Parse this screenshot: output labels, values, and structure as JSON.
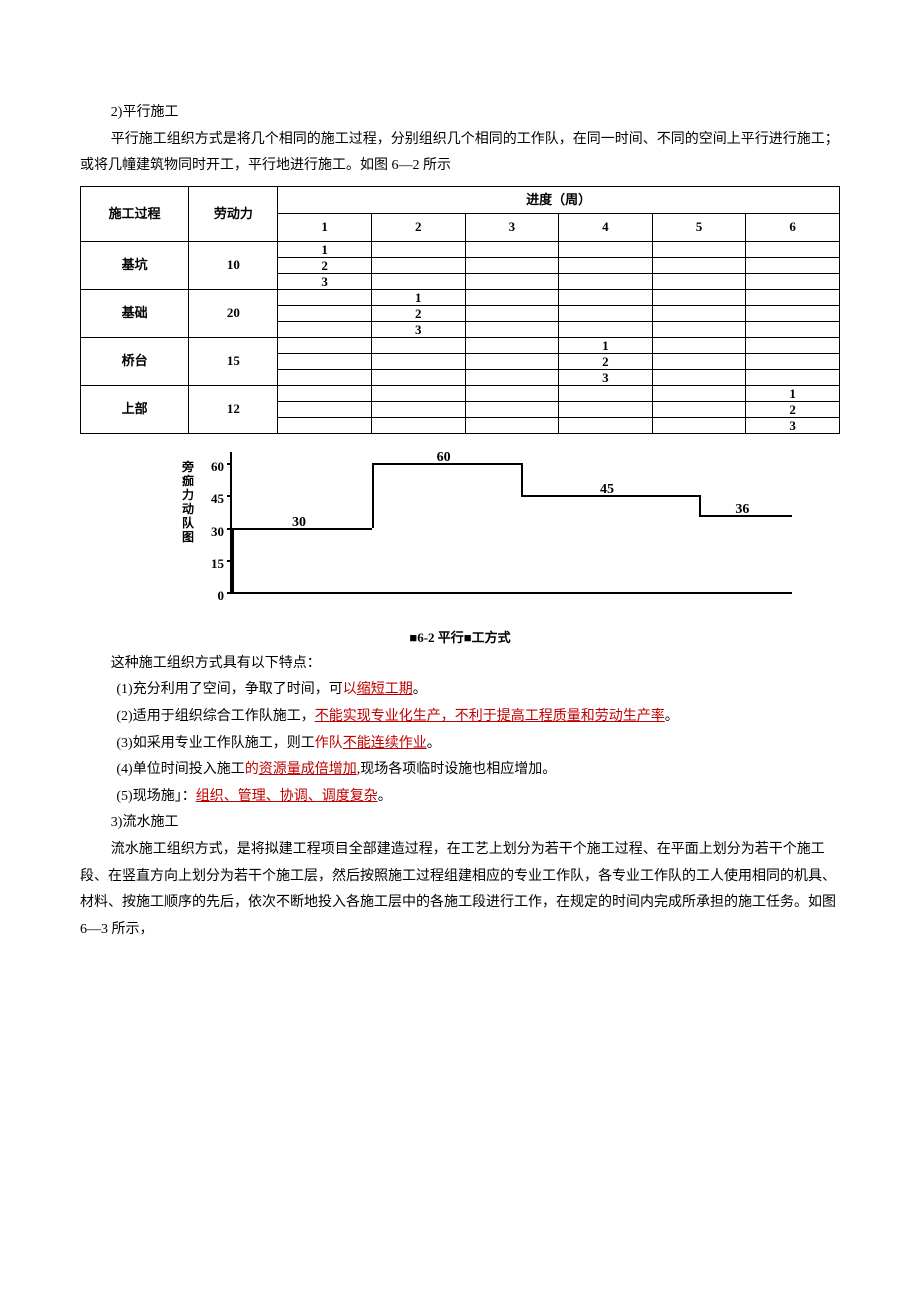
{
  "domain": "Document",
  "body": {
    "h2a_num": "2)",
    "h2a_title": "平行施工",
    "p1": "平行施工组织方式是将几个相同的施工过程，分别组织几个相同的工作队，在同一时间、不同的空间上平行进行施工；或将几幢建筑物同时开工，平行地进行施工。如图 6—2 所示",
    "intro2": "这种施工组织方式具有以下特点：",
    "pt1a": "(1)充分利用了空间，争取了时间，可",
    "pt1b": "以",
    "pt1c": "缩短工期",
    "pt1d": "。",
    "pt2a": "(2)适用于组织综合工作队施工，",
    "pt2b": "不能实现专业化生产，不利于提高工程质量和劳动生产率",
    "pt2c": "。",
    "pt3a": "(3)如采用专业工作队施工，则工",
    "pt3b": "作队",
    "pt3c": "不能连续作业",
    "pt3d": "。",
    "pt4a": "(4)单位时间投入施工",
    "pt4b": "的",
    "pt4c": "资源量成倍增加",
    "pt4d": ",现场各项临时设施也相应增加。",
    "pt5a": "(5)现场施」：",
    "pt5b": "组织、管理、协调、调度复杂",
    "pt5c": "。",
    "h2b_num": "3)",
    "h2b_title": "流水施工",
    "p2": "流水施工组织方式，是将拟建工程项目全部建造过程，在工艺上划分为若干个施工过程、在平面上划分为若干个施工段、在竖直方向上划分为若干个施工层，然后按照施工过程组建相应的专业工作队，各专业工作队的工人使用相同的机具、材料、按施工顺序的先后，依次不断地投入各施工层中的各施工段进行工作，在规定的时间内完成所承担的施工任务。如图 6—3 所示，"
  },
  "schedule_table": {
    "col_proc": "施工过程",
    "col_labor": "劳动力",
    "col_prog": "进度（周）",
    "weeks": [
      "1",
      "2",
      "3",
      "4",
      "5",
      "6"
    ],
    "rows": [
      {
        "proc": "基坑",
        "labor": "10",
        "segments": [
          {
            "col": 0,
            "n": "1"
          },
          {
            "col": 0,
            "n": "2"
          },
          {
            "col": 0,
            "n": "3"
          }
        ]
      },
      {
        "proc": "基础",
        "labor": "20",
        "segments": [
          {
            "col": 1,
            "n": "1"
          },
          {
            "col": 1,
            "n": "2"
          },
          {
            "col": 1,
            "n": "3"
          }
        ]
      },
      {
        "proc": "桥台",
        "labor": "15",
        "segments": [
          {
            "col": 3,
            "n": "1"
          },
          {
            "col": 3,
            "n": "2"
          },
          {
            "col": 3,
            "n": "3"
          }
        ]
      },
      {
        "proc": "上部",
        "labor": "12",
        "segments": [
          {
            "col": 5,
            "n": "1"
          },
          {
            "col": 5,
            "n": "2"
          },
          {
            "col": 5,
            "n": "3"
          }
        ]
      }
    ]
  },
  "chart_data": {
    "type": "step-line",
    "ylabel_vert": "旁痂力动队图",
    "ylabel_note": "劳动力动态图",
    "yticks": [
      0,
      15,
      30,
      45,
      60
    ],
    "ylim": [
      0,
      65
    ],
    "xlim": [
      0,
      6
    ],
    "steps": [
      {
        "x0": 0,
        "x1": 1.5,
        "y": 30,
        "label": "30"
      },
      {
        "x0": 1.5,
        "x1": 3.1,
        "y": 60,
        "label": "60"
      },
      {
        "x0": 3.1,
        "x1": 5.0,
        "y": 45,
        "label": "45"
      },
      {
        "x0": 5.0,
        "x1": 6.0,
        "y": 36,
        "label": "36"
      }
    ],
    "caption_a": "■6-2",
    "caption_b": " 平行■工方式"
  }
}
